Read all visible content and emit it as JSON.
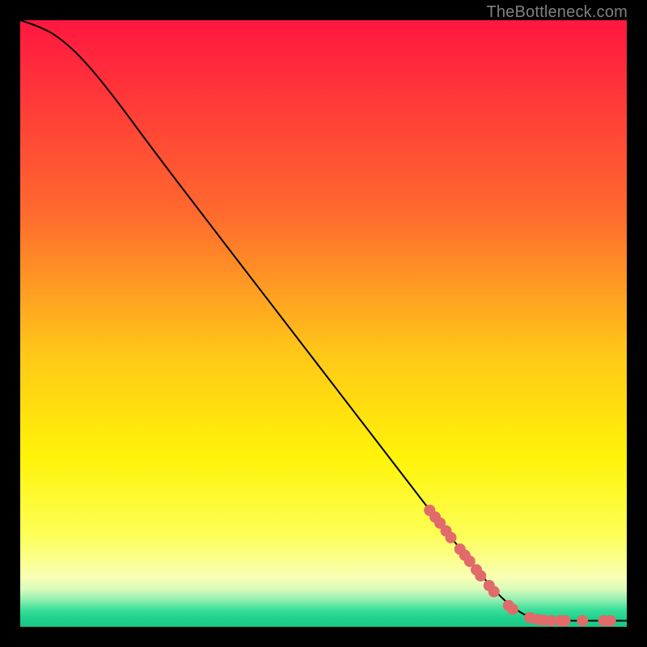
{
  "watermark": "TheBottleneck.com",
  "chart_data": {
    "type": "line",
    "title": "",
    "xlabel": "",
    "ylabel": "",
    "xlim": [
      0,
      100
    ],
    "ylim": [
      0,
      100
    ],
    "grid": false,
    "curve": [
      {
        "x": 0,
        "y": 100
      },
      {
        "x": 3,
        "y": 99
      },
      {
        "x": 6,
        "y": 97.5
      },
      {
        "x": 10,
        "y": 94
      },
      {
        "x": 15,
        "y": 88
      },
      {
        "x": 22,
        "y": 78.5
      },
      {
        "x": 30,
        "y": 68
      },
      {
        "x": 40,
        "y": 55
      },
      {
        "x": 50,
        "y": 42
      },
      {
        "x": 60,
        "y": 29
      },
      {
        "x": 70,
        "y": 16
      },
      {
        "x": 78,
        "y": 6
      },
      {
        "x": 82,
        "y": 2.5
      },
      {
        "x": 85,
        "y": 1.2
      },
      {
        "x": 88,
        "y": 1.0
      },
      {
        "x": 100,
        "y": 1.0
      }
    ],
    "scatter": [
      {
        "x": 67.5,
        "y": 19.2
      },
      {
        "x": 68.4,
        "y": 18.1
      },
      {
        "x": 69.2,
        "y": 17.1
      },
      {
        "x": 70.2,
        "y": 15.8
      },
      {
        "x": 71.0,
        "y": 14.7
      },
      {
        "x": 72.5,
        "y": 12.8
      },
      {
        "x": 73.3,
        "y": 11.8
      },
      {
        "x": 74.1,
        "y": 10.8
      },
      {
        "x": 75.2,
        "y": 9.4
      },
      {
        "x": 75.9,
        "y": 8.4
      },
      {
        "x": 77.3,
        "y": 6.8
      },
      {
        "x": 78.1,
        "y": 5.8
      },
      {
        "x": 80.5,
        "y": 3.5
      },
      {
        "x": 81.2,
        "y": 2.9
      },
      {
        "x": 84.0,
        "y": 1.5
      },
      {
        "x": 85.3,
        "y": 1.2
      },
      {
        "x": 86.3,
        "y": 1.1
      },
      {
        "x": 87.5,
        "y": 1.0
      },
      {
        "x": 89.0,
        "y": 1.0
      },
      {
        "x": 89.8,
        "y": 1.0
      },
      {
        "x": 92.7,
        "y": 1.0
      },
      {
        "x": 96.2,
        "y": 1.0
      },
      {
        "x": 97.3,
        "y": 1.0
      }
    ],
    "scatter_color": "#e16a6a",
    "scatter_radius": 7,
    "line_color": "#000000",
    "gradient_stops": [
      {
        "offset": 0,
        "color": "#ff1740"
      },
      {
        "offset": 0.32,
        "color": "#ff6a2e"
      },
      {
        "offset": 0.55,
        "color": "#ffc818"
      },
      {
        "offset": 0.72,
        "color": "#fff308"
      },
      {
        "offset": 0.85,
        "color": "#fdff58"
      },
      {
        "offset": 0.918,
        "color": "#f9ffb4"
      },
      {
        "offset": 0.938,
        "color": "#d7fbb9"
      },
      {
        "offset": 0.955,
        "color": "#93efb0"
      },
      {
        "offset": 0.972,
        "color": "#3adf9a"
      },
      {
        "offset": 0.985,
        "color": "#1fd28e"
      },
      {
        "offset": 1.0,
        "color": "#19c985"
      }
    ]
  }
}
